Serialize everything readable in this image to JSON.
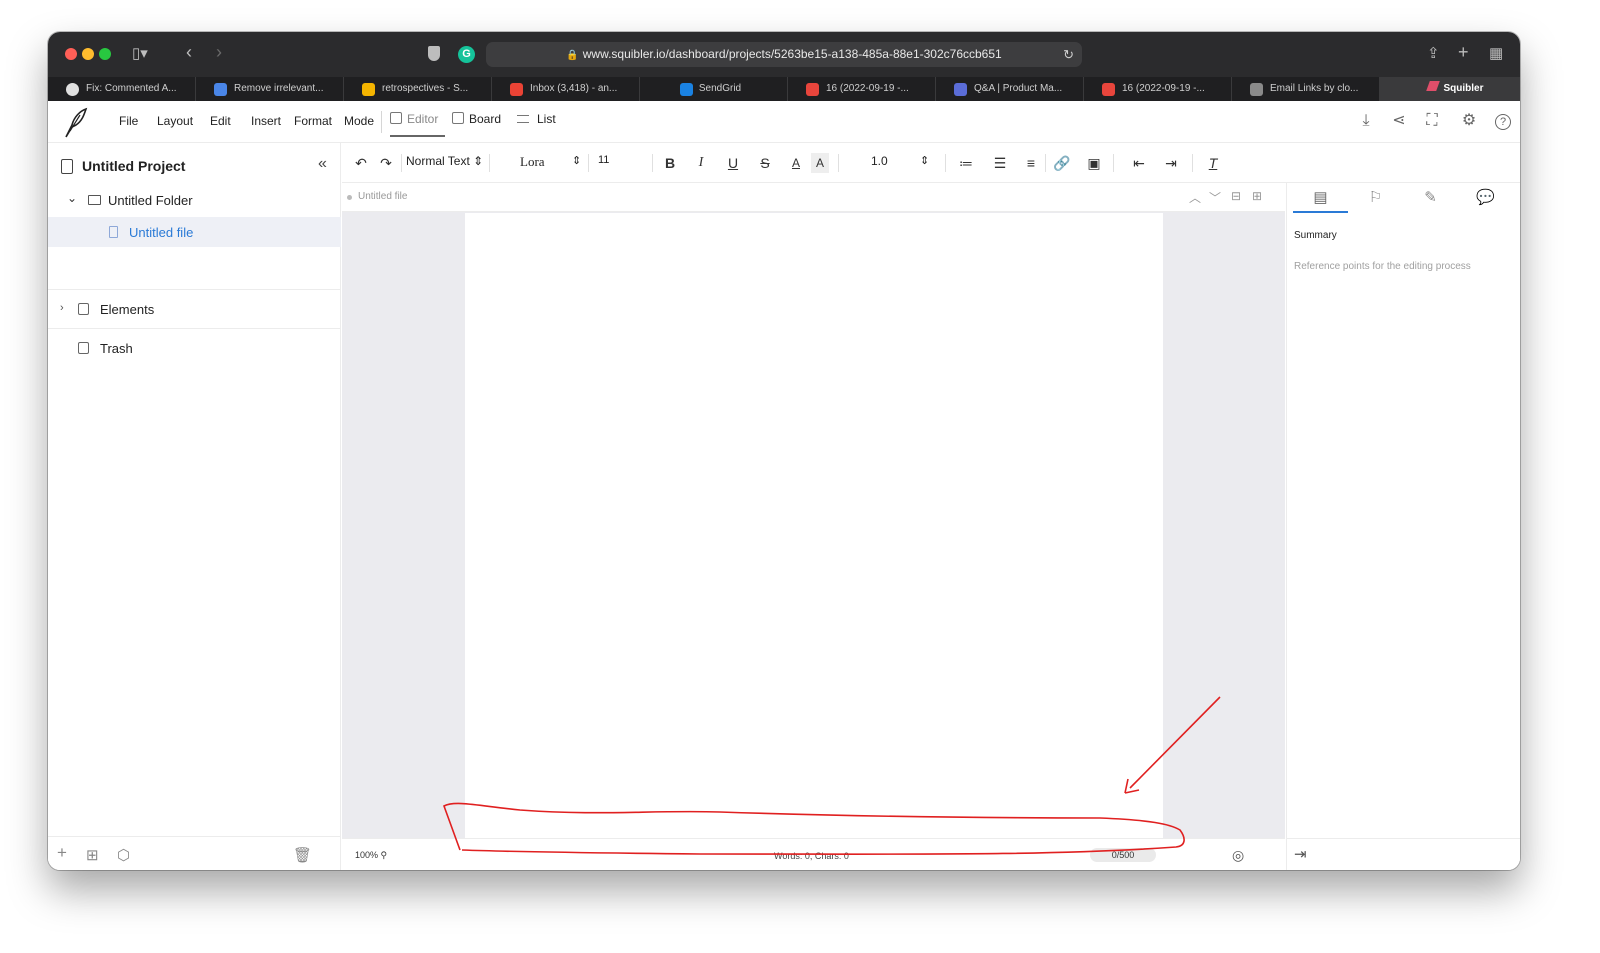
{
  "browser": {
    "url": "www.squibler.io/dashboard/projects/5263be15-a138-485a-88e1-302c76ccb651",
    "tabs": [
      {
        "label": "Fix: Commented A...",
        "color": "#e0e0e0"
      },
      {
        "label": "Remove irrelevant...",
        "color": "#4a86e8"
      },
      {
        "label": "retrospectives - S...",
        "color": "#f4b400"
      },
      {
        "label": "Inbox (3,418) - an...",
        "color": "#ea4335"
      },
      {
        "label": "SendGrid",
        "color": "#1a82e2"
      },
      {
        "label": "16 (2022-09-19 -...",
        "color": "#e8453c"
      },
      {
        "label": "Q&A | Product Ma...",
        "color": "#5b6dd8"
      },
      {
        "label": "16 (2022-09-19 -...",
        "color": "#e8453c"
      },
      {
        "label": "Email Links by clo...",
        "color": "#8a8a8a"
      },
      {
        "label": "Squibler",
        "color": "#e04e6a"
      }
    ]
  },
  "menubar": {
    "items": [
      "File",
      "Layout",
      "Edit",
      "Insert",
      "Format",
      "Mode"
    ],
    "modes": [
      "Editor",
      "Board",
      "List"
    ]
  },
  "sidebar": {
    "project_title": "Untitled Project",
    "folder": "Untitled Folder",
    "file": "Untitled file",
    "elements": "Elements",
    "trash": "Trash"
  },
  "toolbar": {
    "style": "Normal Text",
    "font": "Lora",
    "size": "11",
    "line_spacing": "1.0"
  },
  "editor": {
    "file_name": "Untitled file",
    "zoom": "100%",
    "word_count": "Words: 0, Chars: 0",
    "goal": "0/500"
  },
  "right_panel": {
    "title": "Summary",
    "hint": "Reference points for the editing process"
  },
  "colors": {
    "accent": "#2a7ad6",
    "annotation": "#e02020"
  }
}
